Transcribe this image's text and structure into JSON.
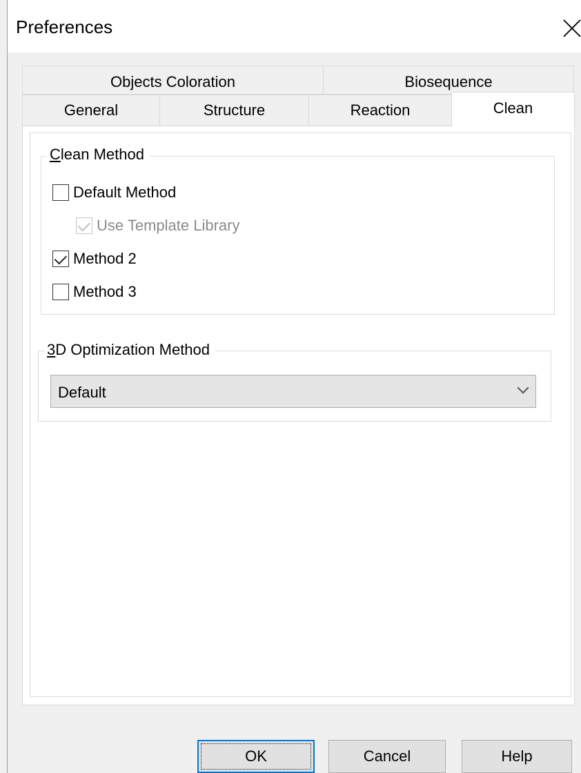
{
  "window": {
    "title": "Preferences",
    "close_icon": "close-icon"
  },
  "tabs": {
    "row1": [
      "Objects Coloration",
      "Biosequence"
    ],
    "row2": [
      "General",
      "Structure",
      "Reaction",
      "Clean"
    ],
    "active": "Clean"
  },
  "clean_method": {
    "legend_mnemonic": "C",
    "legend_rest": "lean Method",
    "options": [
      {
        "label": "Default Method",
        "checked": false,
        "enabled": true
      },
      {
        "label": "Use Template Library",
        "checked": true,
        "enabled": false
      },
      {
        "label": "Method 2",
        "checked": true,
        "enabled": true
      },
      {
        "label": "Method 3",
        "checked": false,
        "enabled": true
      }
    ]
  },
  "optimization": {
    "legend_mnemonic": "3",
    "legend_rest": "D Optimization Method",
    "selected": "Default"
  },
  "buttons": {
    "ok": "OK",
    "cancel": "Cancel",
    "help": "Help"
  },
  "colors": {
    "focus_border": "#0078d7",
    "page_bg": "#ffffff",
    "dialog_bg": "#f0f0f0"
  }
}
